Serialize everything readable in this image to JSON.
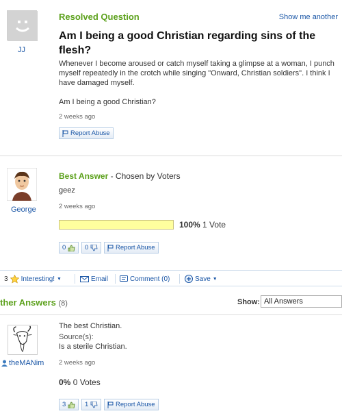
{
  "question": {
    "asker": "JJ",
    "status": "Resolved Question",
    "show_another": "Show me another",
    "title": "Am I being a good Christian regarding sins of the flesh?",
    "body": "Whenever I become aroused or catch myself taking a glimpse at a woman, I punch myself repeatedly in the crotch while singing \"Onward, Christian soldiers\". I think I have damaged myself.",
    "body2": "Am I being a good Christian?",
    "time": "2 weeks ago",
    "report": "Report Abuse"
  },
  "best_answer": {
    "label": "Best Answer",
    "chosen_by": " - Chosen by Voters",
    "user": "George",
    "text": "geez",
    "time": "2 weeks ago",
    "vote_percent": "100%",
    "vote_count": "1 Vote",
    "vote_fraction": 1.0,
    "thumbs_up": "0",
    "thumbs_down": "0",
    "report": "Report Abuse"
  },
  "toolbar": {
    "interesting_count": "3",
    "interesting": "Interesting!",
    "email": "Email",
    "comment": "Comment (0)",
    "save": "Save"
  },
  "other_answers": {
    "title": "ther Answers",
    "count": "(8)",
    "show_label": "Show:",
    "show_value": "All Answers"
  },
  "answer2": {
    "user": "theMANim",
    "text": "The best Christian.",
    "sources_label": "Source(s):",
    "source": "Is a sterile Christian.",
    "time": "2 weeks ago",
    "vote_percent": "0%",
    "vote_count": "0 Votes",
    "thumbs_up": "3",
    "thumbs_down": "1",
    "report": "Report Abuse"
  },
  "colors": {
    "green": "#5ca11c",
    "link_blue": "#1a56a6"
  }
}
